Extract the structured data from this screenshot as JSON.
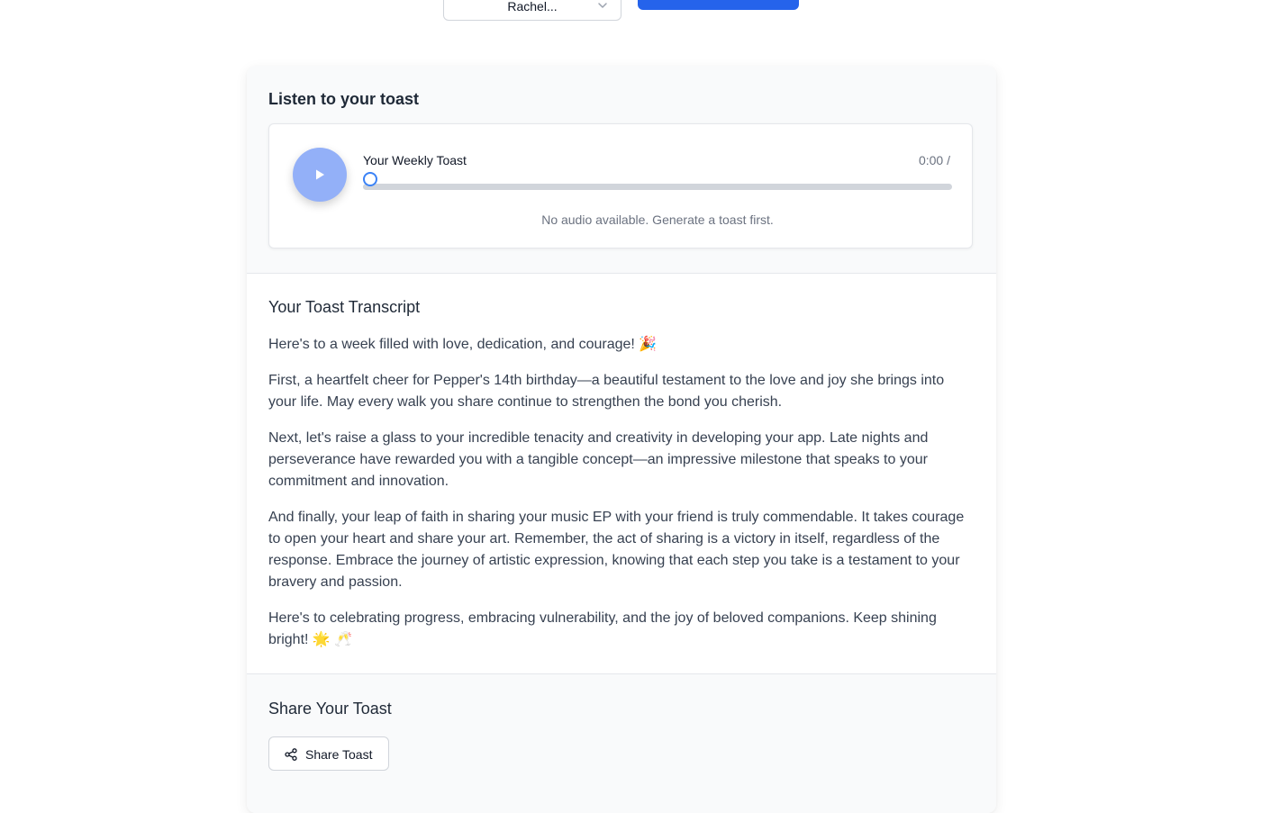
{
  "header": {
    "voice_select_value": "Rachel..."
  },
  "listen": {
    "title": "Listen to your toast",
    "track_title": "Your Weekly Toast",
    "time": "0:00 /",
    "status": "No audio available. Generate a toast first.",
    "progress": 0
  },
  "transcript": {
    "title": "Your Toast Transcript",
    "paragraphs": [
      "Here's to a week filled with love, dedication, and courage! 🎉",
      "First, a heartfelt cheer for Pepper's 14th birthday—a beautiful testament to the love and joy she brings into your life. May every walk you share continue to strengthen the bond you cherish.",
      "Next, let's raise a glass to your incredible tenacity and creativity in developing your app. Late nights and perseverance have rewarded you with a tangible concept—an impressive milestone that speaks to your commitment and innovation.",
      "And finally, your leap of faith in sharing your music EP with your friend is truly commendable. It takes courage to open your heart and share your art. Remember, the act of sharing is a victory in itself, regardless of the response. Embrace the journey of artistic expression, knowing that each step you take is a testament to your bravery and passion.",
      "Here's to celebrating progress, embracing vulnerability, and the joy of beloved companions. Keep shining bright! 🌟 🥂"
    ]
  },
  "share": {
    "title": "Share Your Toast",
    "button_label": "Share Toast"
  },
  "colors": {
    "accent": "#2563eb",
    "play_button": "#93b0f8",
    "progress_thumb": "#3b82f6"
  },
  "icons": {
    "play": "play-icon",
    "share": "share-icon",
    "chevron": "chevron-down-icon"
  }
}
